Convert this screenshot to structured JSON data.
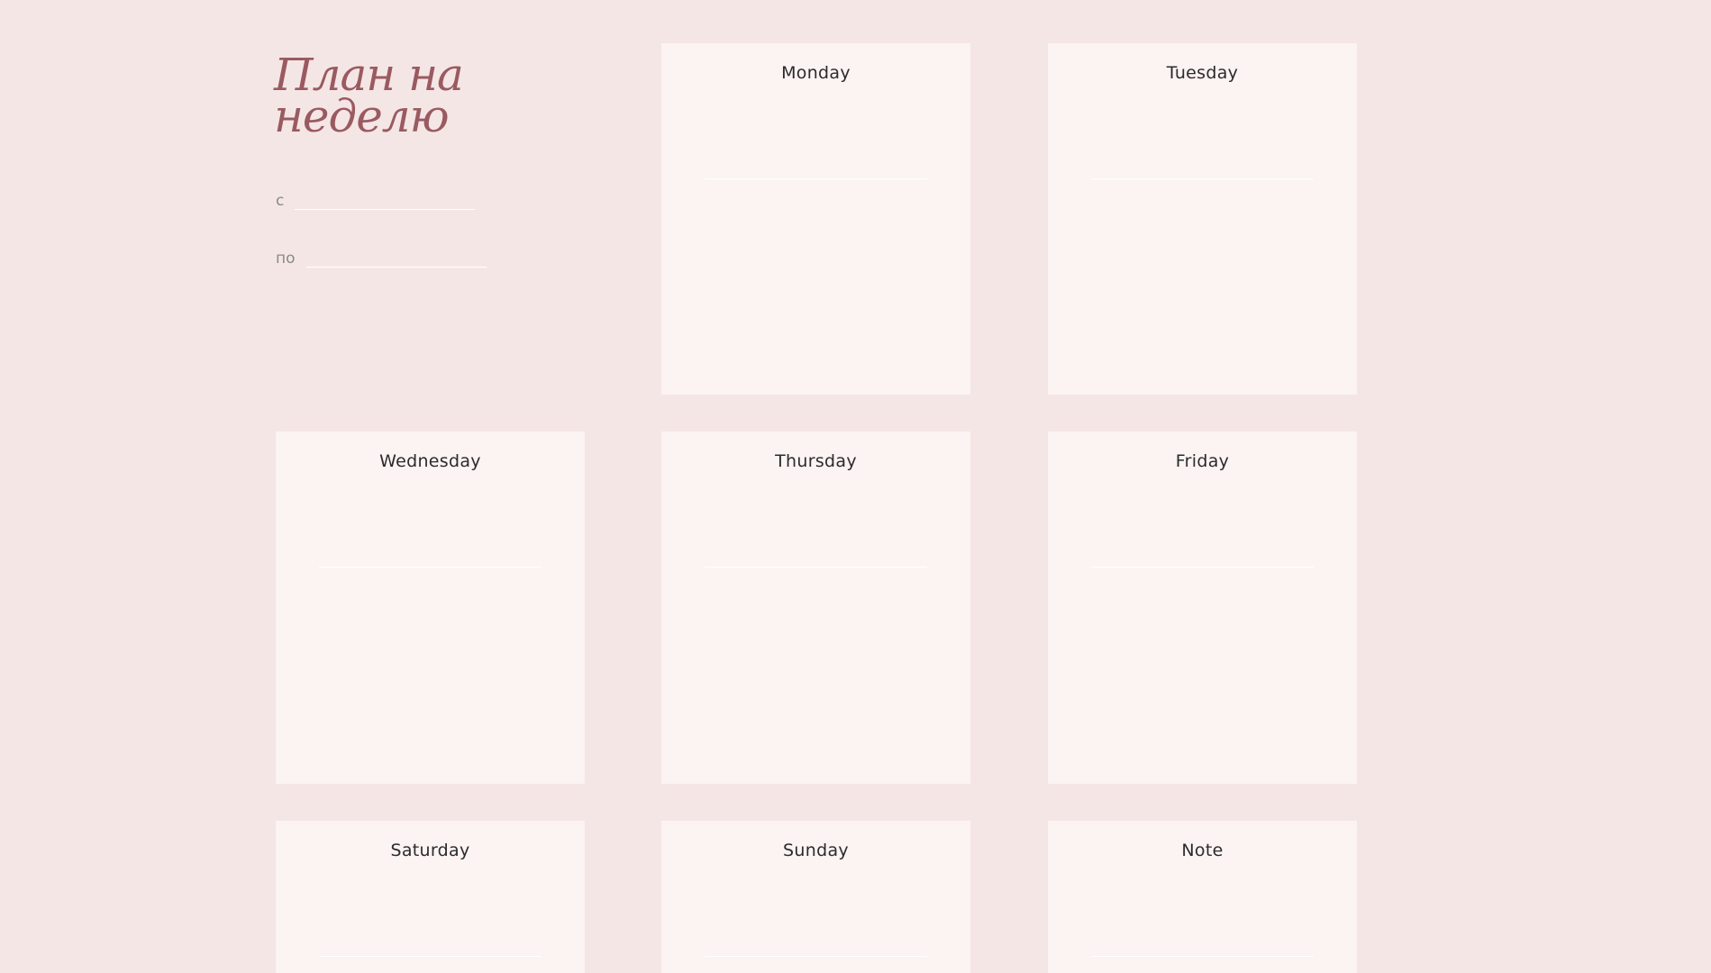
{
  "planner": {
    "title": "План на неделю",
    "from_label": "с",
    "to_label": "по",
    "from_value": "",
    "to_value": ""
  },
  "days": [
    {
      "label": "Monday",
      "value": ""
    },
    {
      "label": "Tuesday",
      "value": ""
    },
    {
      "label": "Wednesday",
      "value": ""
    },
    {
      "label": "Thursday",
      "value": ""
    },
    {
      "label": "Friday",
      "value": ""
    },
    {
      "label": "Saturday",
      "value": ""
    },
    {
      "label": "Sunday",
      "value": ""
    },
    {
      "label": "Note",
      "value": ""
    }
  ],
  "colors": {
    "background": "#f5e6e6",
    "card": "#fcf3f3",
    "title": "#9a5a60",
    "text": "#2b2b2b",
    "muted": "#8a8a8a",
    "line": "#ffffff"
  }
}
